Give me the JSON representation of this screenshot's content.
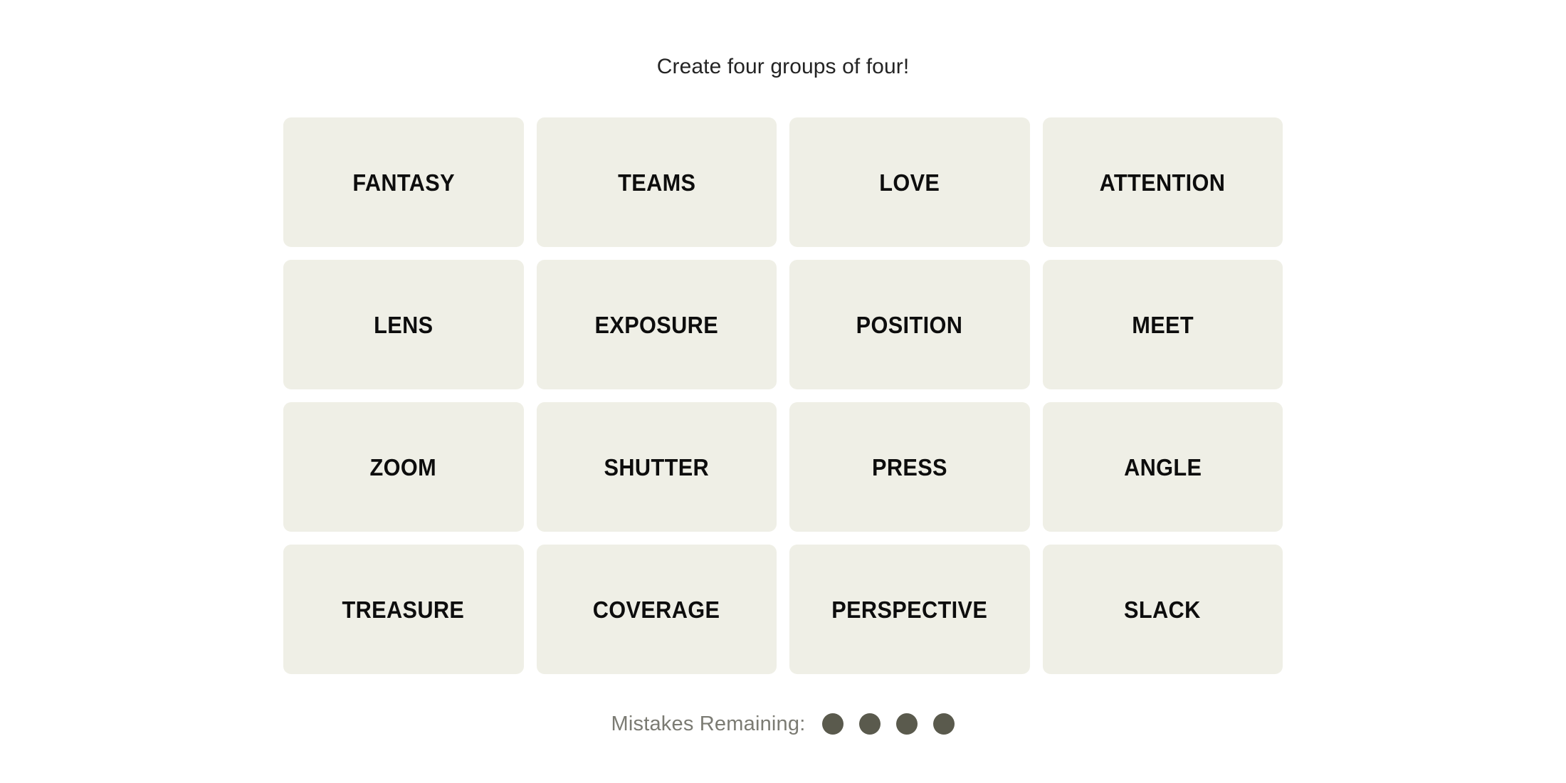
{
  "header": {
    "title": "Create four groups of four!"
  },
  "board": {
    "rows": 4,
    "columns": 4,
    "tile_background": "#EFEFE6",
    "tile_text_color": "#0d0d0d",
    "tiles": [
      {
        "label": "FANTASY"
      },
      {
        "label": "TEAMS"
      },
      {
        "label": "LOVE"
      },
      {
        "label": "ATTENTION"
      },
      {
        "label": "LENS"
      },
      {
        "label": "EXPOSURE"
      },
      {
        "label": "POSITION"
      },
      {
        "label": "MEET"
      },
      {
        "label": "ZOOM"
      },
      {
        "label": "SHUTTER"
      },
      {
        "label": "PRESS"
      },
      {
        "label": "ANGLE"
      },
      {
        "label": "TREASURE"
      },
      {
        "label": "COVERAGE"
      },
      {
        "label": "PERSPECTIVE"
      },
      {
        "label": "SLACK"
      }
    ]
  },
  "status": {
    "mistakes_label": "Mistakes Remaining:",
    "mistakes_remaining": 4,
    "dot_color": "#5a5a4d",
    "label_color": "#7b7b73",
    "dots": [
      {
        "name": "mistake-dot-1"
      },
      {
        "name": "mistake-dot-2"
      },
      {
        "name": "mistake-dot-3"
      },
      {
        "name": "mistake-dot-4"
      }
    ]
  }
}
